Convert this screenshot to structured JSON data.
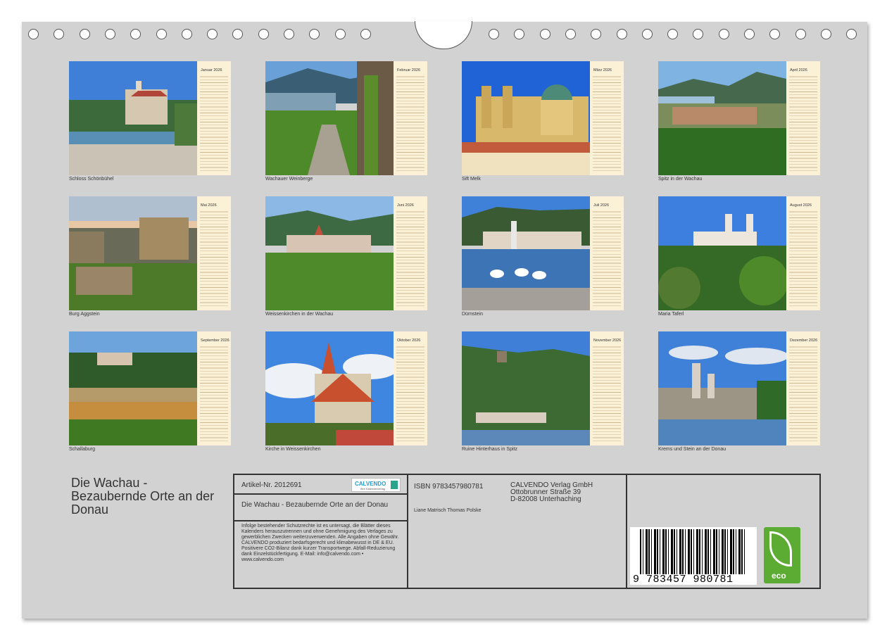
{
  "months": [
    {
      "name": "Januar 2026",
      "caption": "Schloss Schönbühel"
    },
    {
      "name": "Februar 2026",
      "caption": "Wachauer Weinberge"
    },
    {
      "name": "März 2026",
      "caption": "Sift Melk"
    },
    {
      "name": "April 2026",
      "caption": "Spitz in der Wachau"
    },
    {
      "name": "Mai 2026",
      "caption": "Burg Aggstein"
    },
    {
      "name": "Juni 2026",
      "caption": "Weissenkirchen in der Wachau"
    },
    {
      "name": "Juli 2026",
      "caption": "Dürnstein"
    },
    {
      "name": "August 2026",
      "caption": "Maria Taferl"
    },
    {
      "name": "September 2026",
      "caption": "Schallaburg"
    },
    {
      "name": "Oktober 2026",
      "caption": "Kirche in Weissenkirchen"
    },
    {
      "name": "November 2026",
      "caption": "Ruine Hinterhaus in Spitz"
    },
    {
      "name": "Dezember 2026",
      "caption": "Krems und Stein an der Donau"
    }
  ],
  "title": "Die Wachau - Bezaubernde Orte an der Donau",
  "info": {
    "article": "Artikel-Nr. 2012691",
    "logo": "CALVENDO",
    "logo_sub": "Ihre Kalenderverlag",
    "subtitle": "Die Wachau - Bezaubernde Orte an der Donau",
    "legal": "Infolge bestehender Schutzrechte ist es untersagt, die Blätter dieses Kalenders herauszutrennen und ohne Genehmigung des Verlages zu gewerblichen Zwecken weiterzuverwenden. Alle Angaben ohne Gewähr. CALVENDO produziert bedarfsgerecht und klimabewusst in DE & EU. Positivere CO2-Bilanz dank kurzer Transportwege. Abfall-Reduzierung dank Einzelstückfertigung. E-Mail: info@calvendo.com • www.calvendo.com",
    "isbn": "ISBN 9783457980781",
    "publisher": [
      "CALVENDO Verlag GmbH",
      "Ottobrunner Straße 39",
      "D-82008 Unterhaching"
    ],
    "author": "Liane Matrisch Thomas Polske",
    "barcode_text": "9 783457 980781",
    "eco": "eco"
  },
  "colors": {
    "sheet": "#d2d2d2",
    "calendar_bg": "#fbf1d6",
    "eco_green": "#5cab32",
    "logo_blue": "#1e9cd7"
  }
}
